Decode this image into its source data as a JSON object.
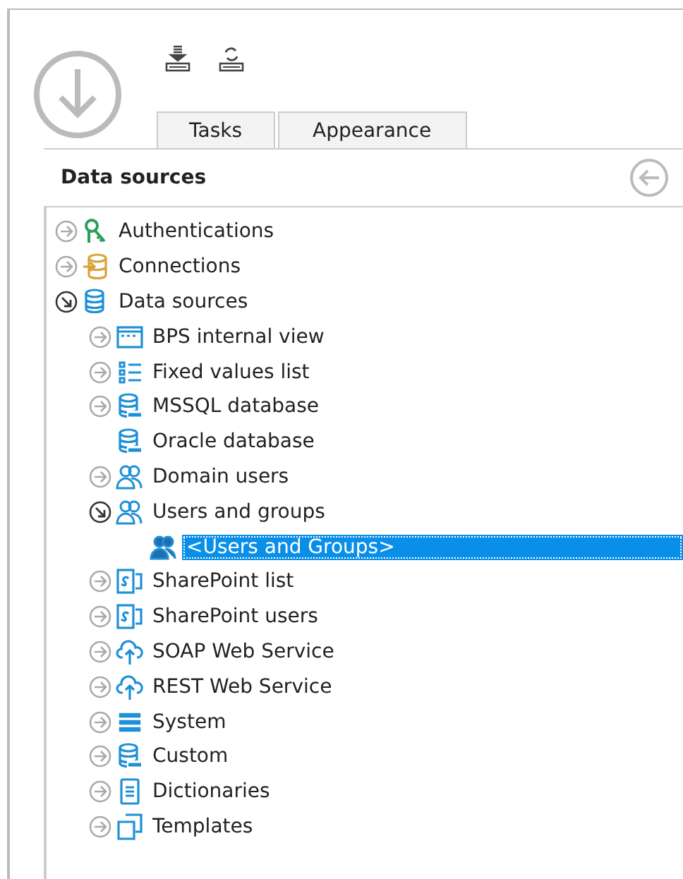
{
  "tabs": [
    {
      "label": "Tasks",
      "selected": false
    },
    {
      "label": "Appearance",
      "selected": false
    }
  ],
  "panel": {
    "title": "Data sources"
  },
  "tree": [
    {
      "label": "Authentications",
      "kind": "key",
      "expanded": false,
      "selected": false
    },
    {
      "label": "Connections",
      "kind": "connection",
      "expanded": false,
      "selected": false
    },
    {
      "label": "Data sources",
      "kind": "database",
      "expanded": true,
      "selected": false,
      "children": [
        {
          "label": "BPS internal view",
          "kind": "view",
          "expanded": false,
          "selected": false
        },
        {
          "label": "Fixed values list",
          "kind": "list",
          "expanded": false,
          "selected": false
        },
        {
          "label": "MSSQL database",
          "kind": "sql",
          "expanded": false,
          "selected": false
        },
        {
          "label": "Oracle database",
          "kind": "ora",
          "selected": false
        },
        {
          "label": "Domain users",
          "kind": "users",
          "expanded": false,
          "selected": false
        },
        {
          "label": "Users and groups",
          "kind": "users",
          "expanded": true,
          "selected": false,
          "children": [
            {
              "label": "<Users and Groups>",
              "kind": "usergroup",
              "selected": true
            }
          ]
        },
        {
          "label": "SharePoint list",
          "kind": "sharepoint",
          "expanded": false,
          "selected": false
        },
        {
          "label": "SharePoint users",
          "kind": "sharepoint",
          "expanded": false,
          "selected": false
        },
        {
          "label": "SOAP Web Service",
          "kind": "cloud",
          "expanded": false,
          "selected": false
        },
        {
          "label": "REST Web Service",
          "kind": "cloud",
          "expanded": false,
          "selected": false
        },
        {
          "label": "System",
          "kind": "stack",
          "expanded": false,
          "selected": false
        },
        {
          "label": "Custom",
          "kind": "custom",
          "expanded": false,
          "selected": false
        },
        {
          "label": "Dictionaries",
          "kind": "document",
          "expanded": false,
          "selected": false
        },
        {
          "label": "Templates",
          "kind": "templates",
          "expanded": false,
          "selected": false
        }
      ]
    }
  ]
}
